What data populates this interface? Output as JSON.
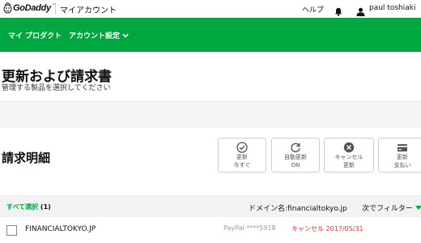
{
  "topbar": {
    "logo_text": "GoDaddy",
    "logo_tm": "™",
    "app_title": "マイアカウント",
    "help_label": "ヘルプ",
    "username": "paul toshiaki"
  },
  "nav": {
    "products_label": "マイ プロダクト",
    "account_settings_label": "アカウント設定"
  },
  "header": {
    "title": "更新および請求書",
    "subtitle": "管理する製品を選択してください"
  },
  "billing": {
    "section_title": "請求明細",
    "actions": [
      {
        "line1": "更新",
        "line2": "今すぐ",
        "icon": "check-circle-icon"
      },
      {
        "line1": "自動更新",
        "line2": "ON",
        "icon": "refresh-icon"
      },
      {
        "line1": "キャンセル",
        "line2": "更新",
        "icon": "cancel-icon"
      },
      {
        "line1": "更新",
        "line2": "支払い",
        "icon": "credit-card-icon"
      }
    ]
  },
  "filter": {
    "select_all_label": "すべて選択",
    "select_count": "(1)",
    "domain_filter": "ドメイン名:financialtokyo.jp",
    "next_filter_label": "次でフィルター"
  },
  "rows": [
    {
      "domain": "FINANCIALTOKYO.JP",
      "payment": "PayPal ****5918",
      "status": "キャンセル 2017/05/31"
    }
  ],
  "colors": {
    "brand_green": "#00a63f",
    "status_red": "#d9382b"
  }
}
